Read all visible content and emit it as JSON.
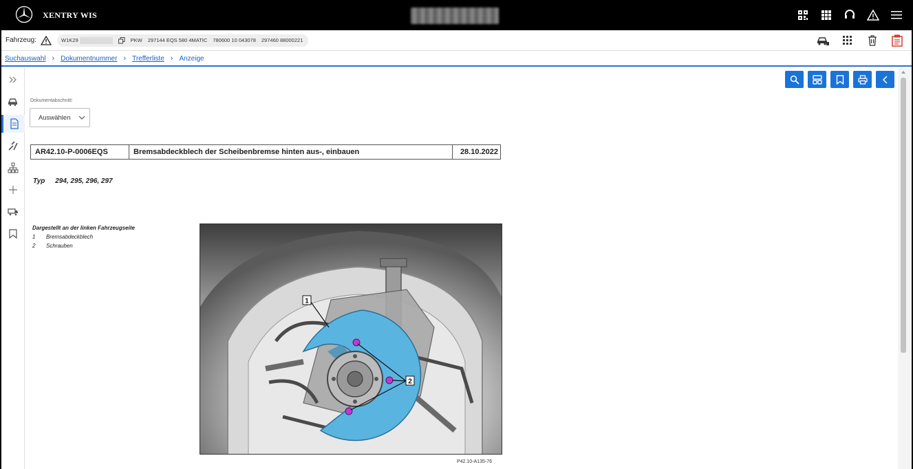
{
  "app": {
    "brand": "XENTRY WIS"
  },
  "vehicle": {
    "label": "Fahrzeug:",
    "vin_prefix": "W1K29",
    "type": "PKW",
    "model": "297144 EQS 580 4MATIC",
    "engine": "780600 10 043078",
    "code": "297460 88000221"
  },
  "breadcrumb": {
    "items": [
      "Suchauswahl",
      "Dokumentnummer",
      "Trefferliste"
    ],
    "current": "Anzeige",
    "separator": ">"
  },
  "section": {
    "label": "Dokumentabschnitt:",
    "dropdown_value": "Auswählen"
  },
  "document": {
    "number": "AR42.10-P-0006EQS",
    "title": "Bremsabdeckblech der Scheibenbremse hinten aus-, einbauen",
    "date": "28.10.2022",
    "typ_label": "Typ",
    "typ_value": "294, 295, 296, 297"
  },
  "legend": {
    "title": "Dargestellt an der linken Fahrzeugseite",
    "items": [
      {
        "num": "1",
        "text": "Bremsabdeckblech"
      },
      {
        "num": "2",
        "text": "Schrauben"
      }
    ]
  },
  "figure": {
    "callout1": "1",
    "callout2": "2",
    "caption": "P42.10-A135-76",
    "highlight_color": "#5ab4e0"
  },
  "colors": {
    "accent": "#1a73d9",
    "topbar": "#000000",
    "link": "#1a5fc4"
  }
}
